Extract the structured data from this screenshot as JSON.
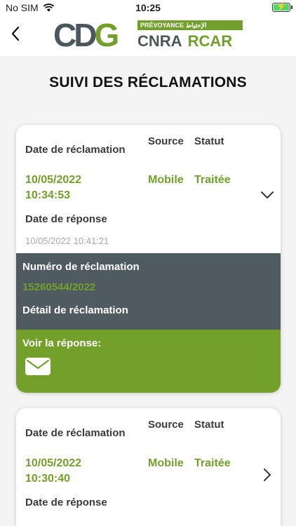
{
  "status_bar": {
    "carrier": "No SIM",
    "time": "10:25"
  },
  "logo": {
    "cdg": "CDG",
    "prevoyance": "PRÉVOYANCE الإحتياط",
    "cnra": "CNRA",
    "rcar": "RCAR"
  },
  "page_title": "SUIVI DES RÉCLAMATIONS",
  "colors": {
    "brand_green": "#72a02a",
    "brand_gray": "#505b61"
  },
  "claims": [
    {
      "date_label": "Date de réclamation",
      "source_label": "Source",
      "status_label": "Statut",
      "date_line1": "10/05/2022",
      "date_line2": "10:34:53",
      "source": "Mobile",
      "status": "Traitée",
      "response_label": "Date de réponse",
      "response_date": "10/05/2022 10:41:21",
      "number_label": "Numéro de réclamation",
      "number": "15260544/2022",
      "detail_label": "Détail de réclamation",
      "see_response_label": "Voir la réponse:",
      "expanded": true
    },
    {
      "date_label": "Date de réclamation",
      "source_label": "Source",
      "status_label": "Statut",
      "date_line1": "10/05/2022",
      "date_line2": "10:30:40",
      "source": "Mobile",
      "status": "Traitée",
      "response_label": "Date de réponse",
      "expanded": false
    }
  ]
}
